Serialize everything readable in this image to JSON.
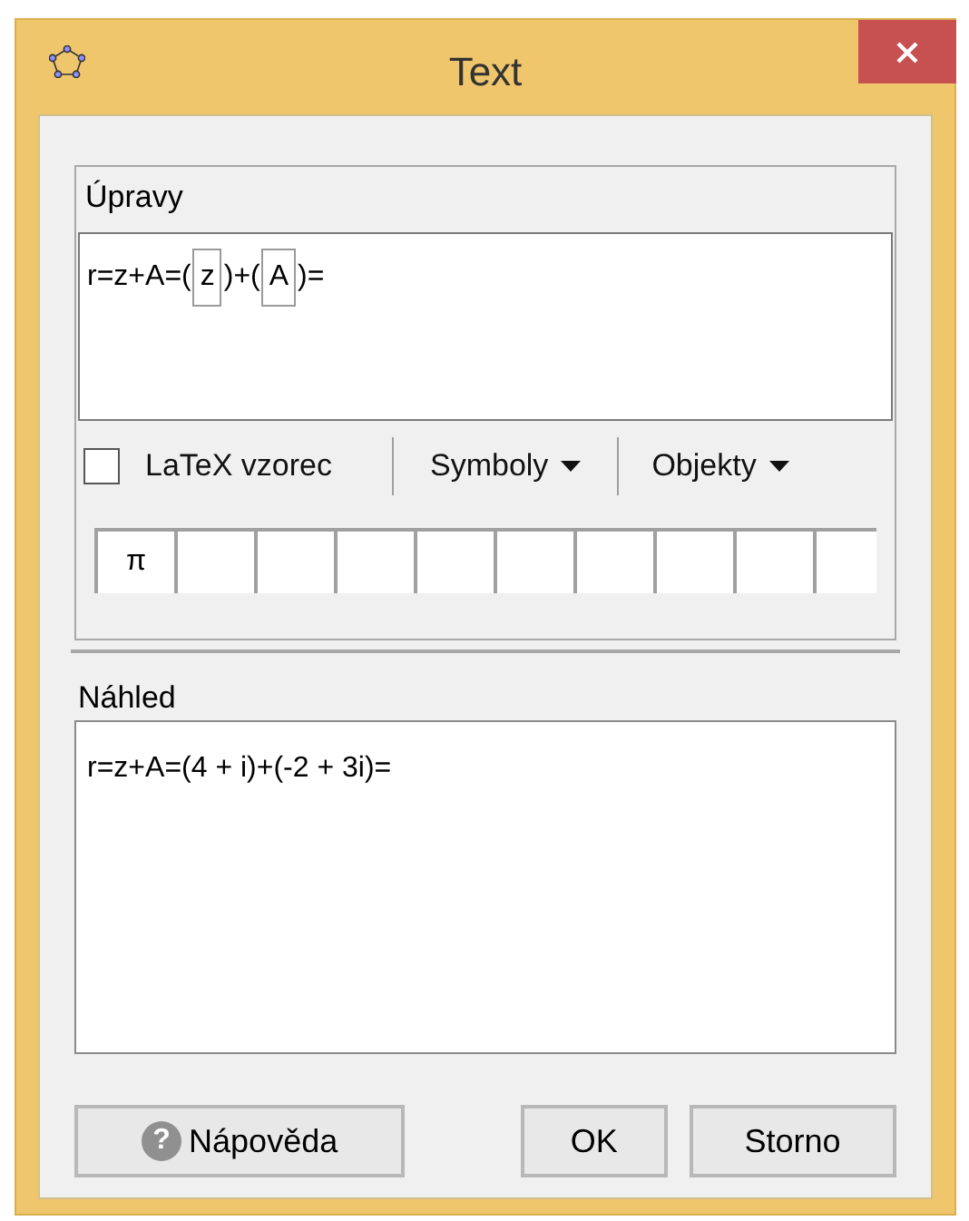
{
  "window": {
    "title": "Text"
  },
  "edit": {
    "label": "Úpravy",
    "content": [
      {
        "kind": "text",
        "text": "r=z+A=("
      },
      {
        "kind": "object",
        "text": "z"
      },
      {
        "kind": "text",
        "text": ")+("
      },
      {
        "kind": "object",
        "text": "A"
      },
      {
        "kind": "text",
        "text": ")="
      }
    ]
  },
  "latex": {
    "label": "LaTeX vzorec",
    "checked": false
  },
  "menus": [
    "Symboly",
    "Objekty"
  ],
  "symbols": [
    "π"
  ],
  "preview": {
    "label": "Náhled",
    "text": "r=z+A=(4 + i)+(-2 + 3i)="
  },
  "buttons": {
    "help": {
      "icon": "?",
      "label": "Nápověda"
    },
    "ok": "OK",
    "cancel": "Storno"
  }
}
